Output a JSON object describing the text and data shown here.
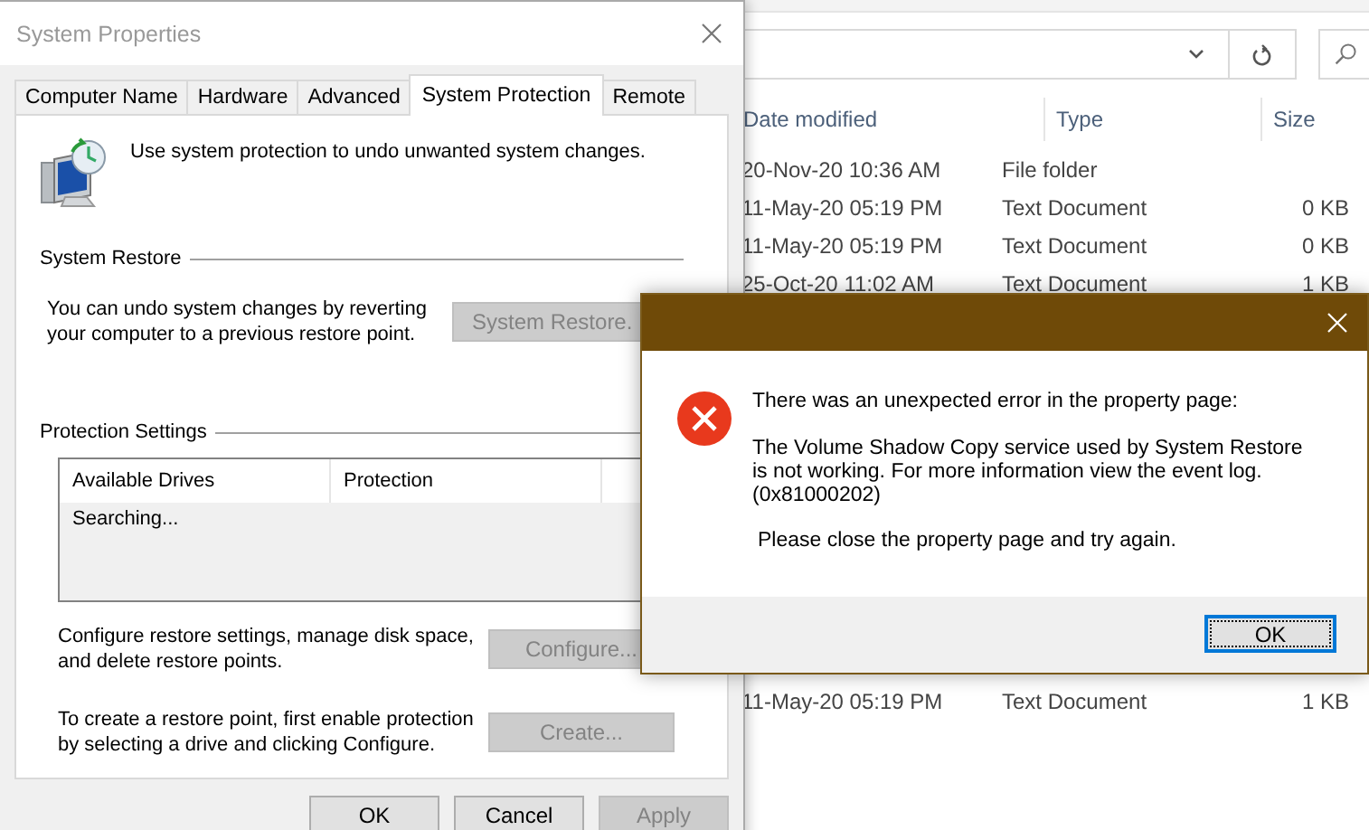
{
  "explorer": {
    "columns": [
      "Date modified",
      "Type",
      "Size"
    ],
    "rows": [
      {
        "date": "20-Nov-20 10:36 AM",
        "type": "File folder"
      },
      {
        "date": "11-May-20 05:19 PM",
        "type": "Text Document",
        "size": "0 KB"
      },
      {
        "date": "11-May-20 05:19 PM",
        "type": "Text Document",
        "size": "0 KB"
      },
      {
        "date": "25-Oct-20 11:02 AM",
        "type": "Text Document",
        "size": "1 KB"
      }
    ],
    "lower_rows": [
      {
        "date": "11-May-20 05:19 PM",
        "type": "Text Document",
        "size": "1 KB"
      }
    ]
  },
  "system_properties": {
    "title": "System Properties",
    "tabs": [
      {
        "label": "Computer Name",
        "selected": false
      },
      {
        "label": "Hardware",
        "selected": false
      },
      {
        "label": "Advanced",
        "selected": false
      },
      {
        "label": "System Protection",
        "selected": true
      },
      {
        "label": "Remote",
        "selected": false
      }
    ],
    "intro": "Use system protection to undo unwanted system changes.",
    "system_restore": {
      "heading": "System Restore",
      "text": "You can undo system changes by reverting your computer to a previous restore point.",
      "button": {
        "label": "System Restore.",
        "disabled": true
      }
    },
    "protection_settings": {
      "heading": "Protection Settings",
      "columns": [
        "Available Drives",
        "Protection"
      ],
      "status": "Searching...",
      "actions": [
        {
          "text": "Configure restore settings, manage disk space, and delete restore points.",
          "button": {
            "label": "Configure...",
            "disabled": true
          }
        },
        {
          "text": "To create a restore point, first enable protection by selecting a drive and clicking Configure.",
          "button": {
            "label": "Create...",
            "disabled": true
          }
        }
      ]
    },
    "buttons": [
      {
        "label": "OK",
        "disabled": false
      },
      {
        "label": "Cancel",
        "disabled": false
      },
      {
        "label": "Apply",
        "disabled": true
      }
    ]
  },
  "error_dialog": {
    "heading": "There was an unexpected error in the property page:",
    "detail": "The Volume Shadow Copy service used by System Restore is not working. For more information view the event log.",
    "code": "(0x81000202)",
    "instruction": "Please close the property page and try again.",
    "button": {
      "label": "OK",
      "focused": true
    }
  }
}
